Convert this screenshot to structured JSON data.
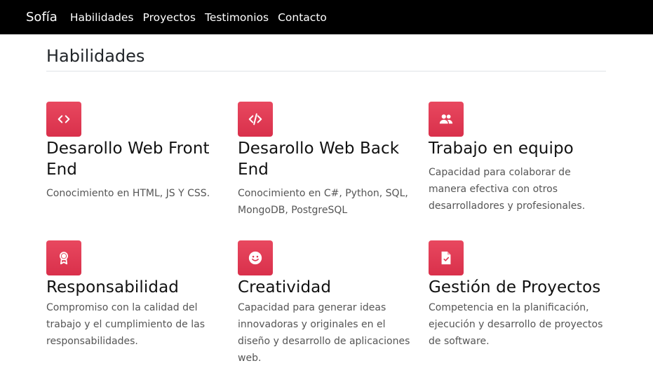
{
  "nav": {
    "brand": "Sofía",
    "links": [
      "Habilidades",
      "Proyectos",
      "Testimonios",
      "Contacto"
    ]
  },
  "section": {
    "title": "Habilidades"
  },
  "skills": [
    {
      "icon": "code-icon",
      "title": "Desarollo Web Front End",
      "text": "Conocimiento en HTML, JS Y CSS."
    },
    {
      "icon": "code-slash-icon",
      "title": "Desarollo Web Back End",
      "text": "Conocimiento en C#, Python, SQL, MongoDB, PostgreSQL"
    },
    {
      "icon": "people-icon",
      "title": "Trabajo en equipo",
      "text": "Capacidad para colaborar de manera efectiva con otros desarrolladores y profesionales."
    },
    {
      "icon": "award-icon",
      "title": "Responsabilidad",
      "text": "Compromiso con la calidad del trabajo y el cumplimiento de las responsabilidades."
    },
    {
      "icon": "smile-icon",
      "title": "Creatividad",
      "text": "Capacidad para generar ideas innovadoras y originales en el diseño y desarrollo de aplicaciones web."
    },
    {
      "icon": "file-check-icon",
      "title": "Gestión de Proyectos",
      "text": "Competencia en la planificación, ejecución y desarrollo de proyectos de software."
    }
  ],
  "colors": {
    "navbar": "#000000",
    "accent": "#e03a53"
  }
}
